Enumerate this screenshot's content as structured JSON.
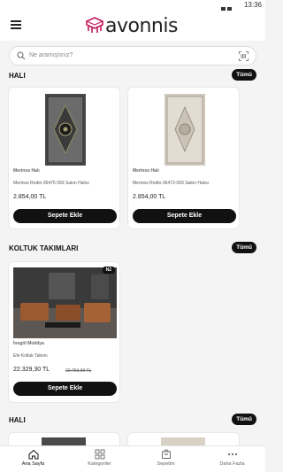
{
  "status_bar": {
    "time": "13:36"
  },
  "header": {
    "brand": "avonnis"
  },
  "search": {
    "placeholder": "Ne aramıştınız?"
  },
  "sections": [
    {
      "title": "HALI",
      "all_label": "Tümü",
      "products": [
        {
          "brand": "Merinos Halı",
          "name": "Merinos Rodin-36475 093 Salon Halısı",
          "price": "2.854,00 TL",
          "button": "Sepete Ekle"
        },
        {
          "brand": "Merinos Halı",
          "name": "Merinos Rodin-36472-093 Salon Halısı",
          "price": "2.854,00 TL",
          "button": "Sepete Ekle"
        }
      ]
    },
    {
      "title": "KOLTUK TAKIMLARI",
      "all_label": "Tümü",
      "products": [
        {
          "badge": "N2",
          "brand": "İnegöl Mobilya",
          "name": "Efe Koltuk Takımı",
          "price": "22.329,30 TL",
          "old_price": "22.756,99 TL",
          "button": "Sepete Ekle"
        }
      ]
    },
    {
      "title": "HALI",
      "all_label": "Tümü"
    }
  ],
  "bottom_nav": [
    {
      "label": "Ana Sayfa",
      "icon": "home-icon",
      "active": true
    },
    {
      "label": "Kategoriler",
      "icon": "grid-icon",
      "active": false
    },
    {
      "label": "Sepetim",
      "icon": "cart-icon",
      "active": false
    },
    {
      "label": "Daha Fazla",
      "icon": "more-icon",
      "active": false
    }
  ]
}
